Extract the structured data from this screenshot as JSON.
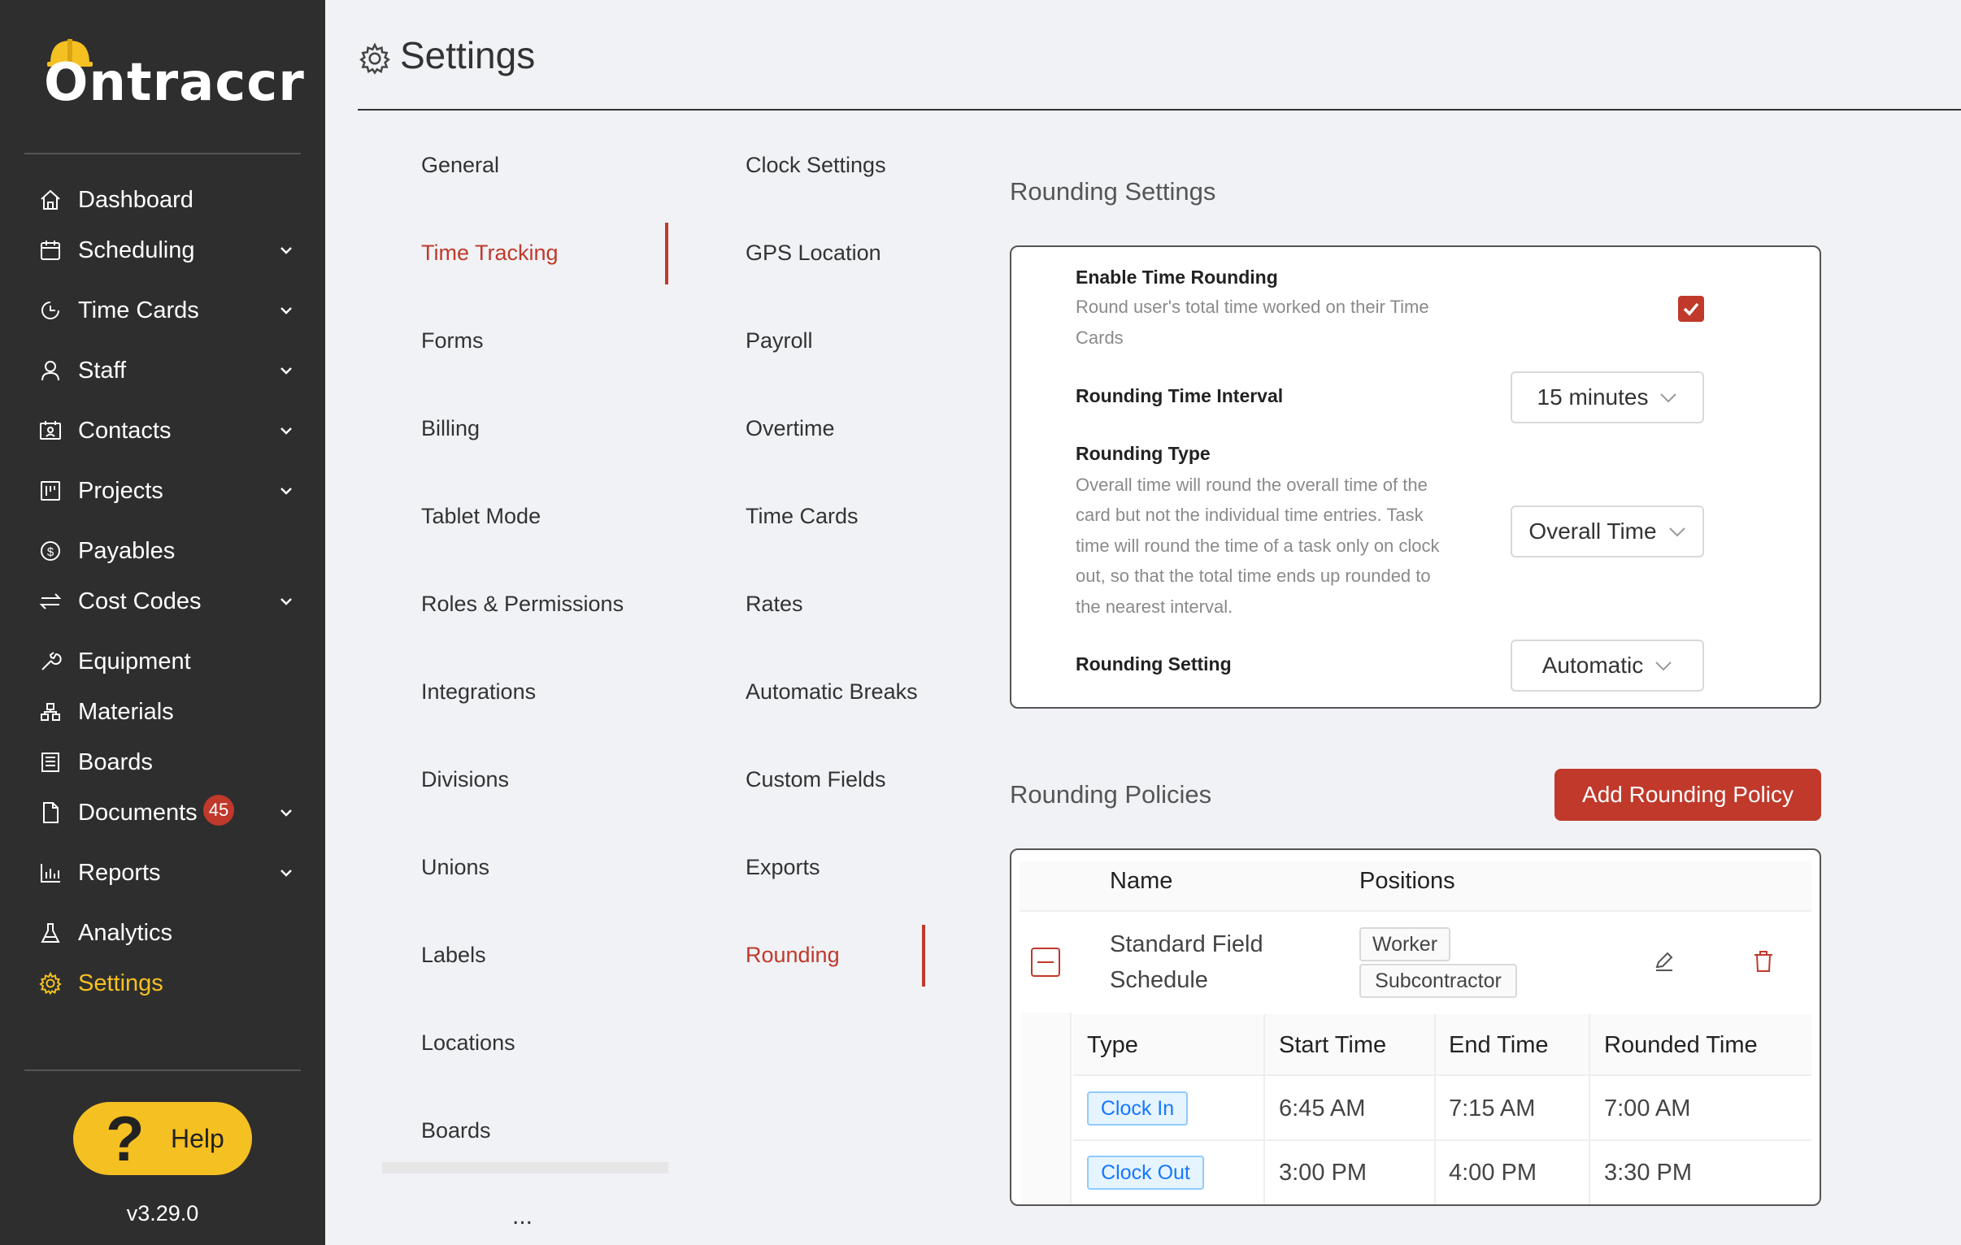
{
  "app": {
    "logo": "Ontraccr",
    "version": "v3.29.0"
  },
  "sidebar": {
    "items": [
      {
        "label": "Dashboard",
        "icon": "home-icon",
        "chevron": false
      },
      {
        "label": "Scheduling",
        "icon": "calendar-icon",
        "chevron": true
      },
      {
        "label": "Time Cards",
        "icon": "clock-icon",
        "chevron": true
      },
      {
        "label": "Staff",
        "icon": "user-icon",
        "chevron": true
      },
      {
        "label": "Contacts",
        "icon": "contacts-icon",
        "chevron": true
      },
      {
        "label": "Projects",
        "icon": "project-icon",
        "chevron": true
      },
      {
        "label": "Payables",
        "icon": "dollar-icon",
        "chevron": false
      },
      {
        "label": "Cost Codes",
        "icon": "swap-icon",
        "chevron": true
      },
      {
        "label": "Equipment",
        "icon": "wrench-icon",
        "chevron": false
      },
      {
        "label": "Materials",
        "icon": "materials-icon",
        "chevron": false
      },
      {
        "label": "Boards",
        "icon": "board-icon",
        "chevron": false
      },
      {
        "label": "Documents",
        "icon": "file-icon",
        "chevron": true,
        "badge": "45"
      },
      {
        "label": "Reports",
        "icon": "bar-chart-icon",
        "chevron": true
      },
      {
        "label": "Analytics",
        "icon": "flask-icon",
        "chevron": false
      },
      {
        "label": "Settings",
        "icon": "gear-icon",
        "chevron": false,
        "active": true
      }
    ],
    "help_label": "Help"
  },
  "header": {
    "title": "Settings"
  },
  "settings_nav": {
    "col1": [
      "General",
      "Time Tracking",
      "Forms",
      "Billing",
      "Tablet Mode",
      "Roles & Permissions",
      "Integrations",
      "Divisions",
      "Unions",
      "Labels",
      "Locations",
      "Boards"
    ],
    "col1_active": "Time Tracking",
    "col1_more": "...",
    "col2": [
      "Clock Settings",
      "GPS Location",
      "Payroll",
      "Overtime",
      "Time Cards",
      "Rates",
      "Automatic Breaks",
      "Custom Fields",
      "Exports",
      "Rounding"
    ],
    "col2_active": "Rounding"
  },
  "rounding_settings": {
    "section_title": "Rounding Settings",
    "enable": {
      "title": "Enable Time Rounding",
      "desc_line1": "Round user's total time worked on their Time",
      "desc_line2": "Cards",
      "checked": true
    },
    "interval": {
      "title": "Rounding Time Interval",
      "value": "15 minutes"
    },
    "type": {
      "title": "Rounding Type",
      "desc_lines": [
        "Overall time will round the overall time of the",
        "card but not the individual time entries. Task",
        "time will round the time of a task only on clock",
        "out, so that the total time ends up rounded to",
        "the nearest interval."
      ],
      "value": "Overall Time"
    },
    "setting": {
      "title": "Rounding Setting",
      "value": "Automatic"
    }
  },
  "rounding_policies": {
    "section_title": "Rounding Policies",
    "add_button": "Add Rounding Policy",
    "columns": {
      "name": "Name",
      "positions": "Positions"
    },
    "policy": {
      "name_line1": "Standard Field",
      "name_line2": "Schedule",
      "positions": [
        "Worker",
        "Subcontractor"
      ]
    },
    "sub_columns": {
      "type": "Type",
      "start": "Start Time",
      "end": "End Time",
      "rounded": "Rounded Time"
    },
    "rules": [
      {
        "type": "Clock In",
        "start": "6:45 AM",
        "end": "7:15 AM",
        "rounded": "7:00 AM"
      },
      {
        "type": "Clock Out",
        "start": "3:00 PM",
        "end": "4:00 PM",
        "rounded": "3:30 PM"
      }
    ]
  },
  "colors": {
    "accent": "#c0392b",
    "sidebar_bg": "#2e2e2e",
    "active_nav": "#f5c021",
    "tag_blue": "#1677ff"
  }
}
